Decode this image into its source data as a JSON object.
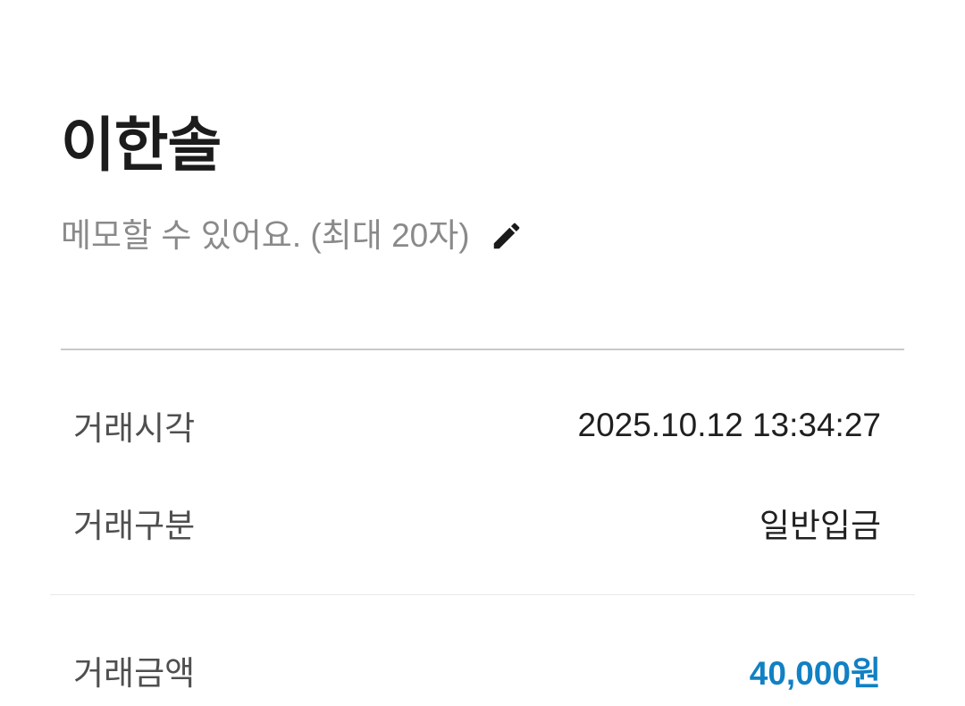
{
  "header": {
    "name": "이한솔"
  },
  "memo": {
    "placeholder": "메모할 수 있어요. (최대 20자)",
    "edit_icon": "pencil-icon"
  },
  "details": {
    "transaction_time_label": "거래시각",
    "transaction_time_value": "2025.10.12 13:34:27",
    "transaction_type_label": "거래구분",
    "transaction_type_value": "일반입금",
    "transaction_amount_label": "거래금액",
    "transaction_amount_value": "40,000원"
  },
  "colors": {
    "amount": "#1180c4",
    "title": "#1c1c1c",
    "memo": "#8a8a8a",
    "label": "#4f4f4f"
  }
}
